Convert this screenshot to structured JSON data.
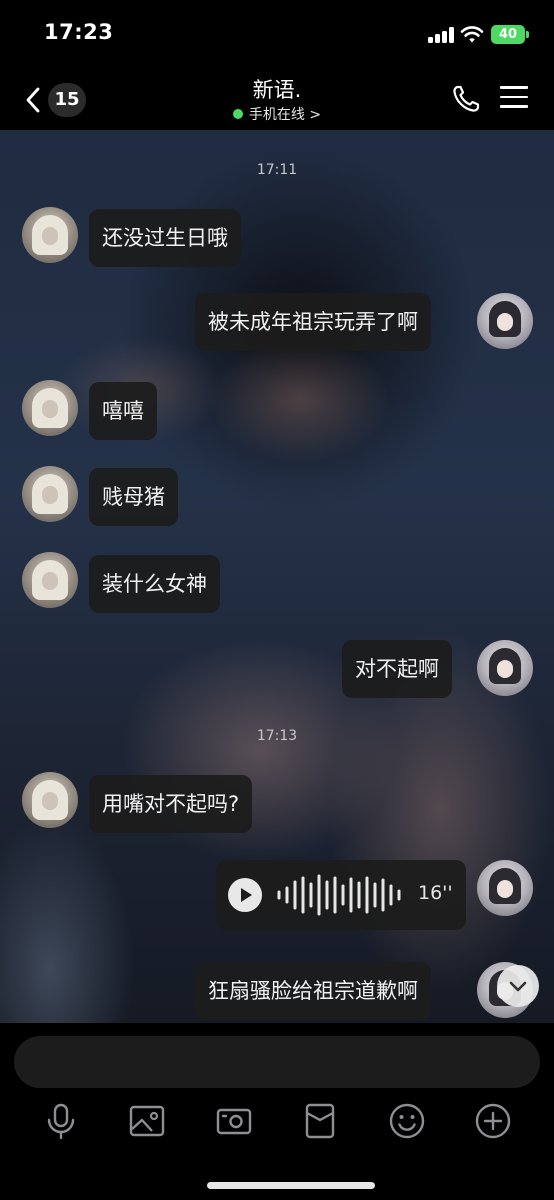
{
  "status_bar": {
    "time": "17:23",
    "battery": "40"
  },
  "header": {
    "unread_count": "15",
    "title": "新语.",
    "presence": "手机在线 >"
  },
  "messages": [
    {
      "type": "timestamp",
      "text": "17:11"
    },
    {
      "side": "left",
      "text": "还没过生日哦"
    },
    {
      "side": "right",
      "text": "被未成年祖宗玩弄了啊"
    },
    {
      "side": "left",
      "text": "嘻嘻"
    },
    {
      "side": "left",
      "text": "贱母猪"
    },
    {
      "side": "left",
      "text": "装什么女神"
    },
    {
      "side": "right",
      "text": "对不起啊"
    },
    {
      "type": "timestamp",
      "text": "17:13"
    },
    {
      "side": "left",
      "text": "用嘴对不起吗?"
    },
    {
      "side": "right",
      "type": "voice",
      "duration": "16''"
    },
    {
      "side": "right",
      "text": "狂扇骚脸给祖宗道歉啊"
    }
  ],
  "input": {
    "value": ""
  },
  "toolbar": {
    "icons": [
      "microphone-icon",
      "image-icon",
      "camera-icon",
      "red-packet-icon",
      "emoji-icon",
      "plus-icon"
    ]
  },
  "colors": {
    "online_dot": "#4cd964",
    "battery": "#4cd964",
    "bubble": "#1c1c1c"
  }
}
